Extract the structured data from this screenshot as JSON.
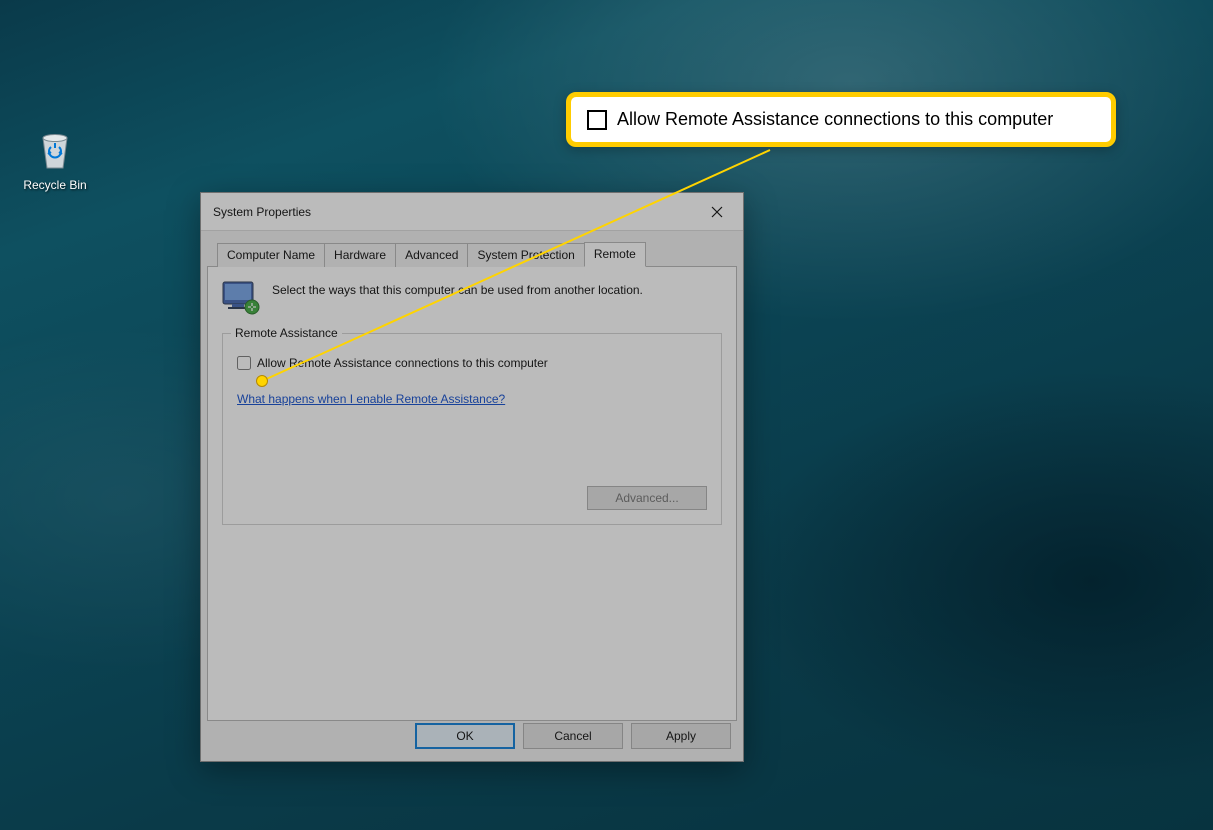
{
  "desktop": {
    "recycle_bin_label": "Recycle Bin"
  },
  "dialog": {
    "title": "System Properties",
    "tabs": [
      "Computer Name",
      "Hardware",
      "Advanced",
      "System Protection",
      "Remote"
    ],
    "active_tab_index": 4,
    "intro_text": "Select the ways that this computer can be used from another location.",
    "group_title": "Remote Assistance",
    "checkbox_label": "Allow Remote Assistance connections to this computer",
    "checkbox_checked": false,
    "help_link": "What happens when I enable Remote Assistance?",
    "advanced_button": "Advanced...",
    "advanced_button_enabled": false,
    "buttons": {
      "ok": "OK",
      "cancel": "Cancel",
      "apply": "Apply"
    }
  },
  "callout": {
    "text": "Allow Remote Assistance connections to this computer"
  },
  "colors": {
    "highlight_border": "#ffcc00",
    "link": "#0645cc",
    "default_btn_border": "#0078d7"
  }
}
